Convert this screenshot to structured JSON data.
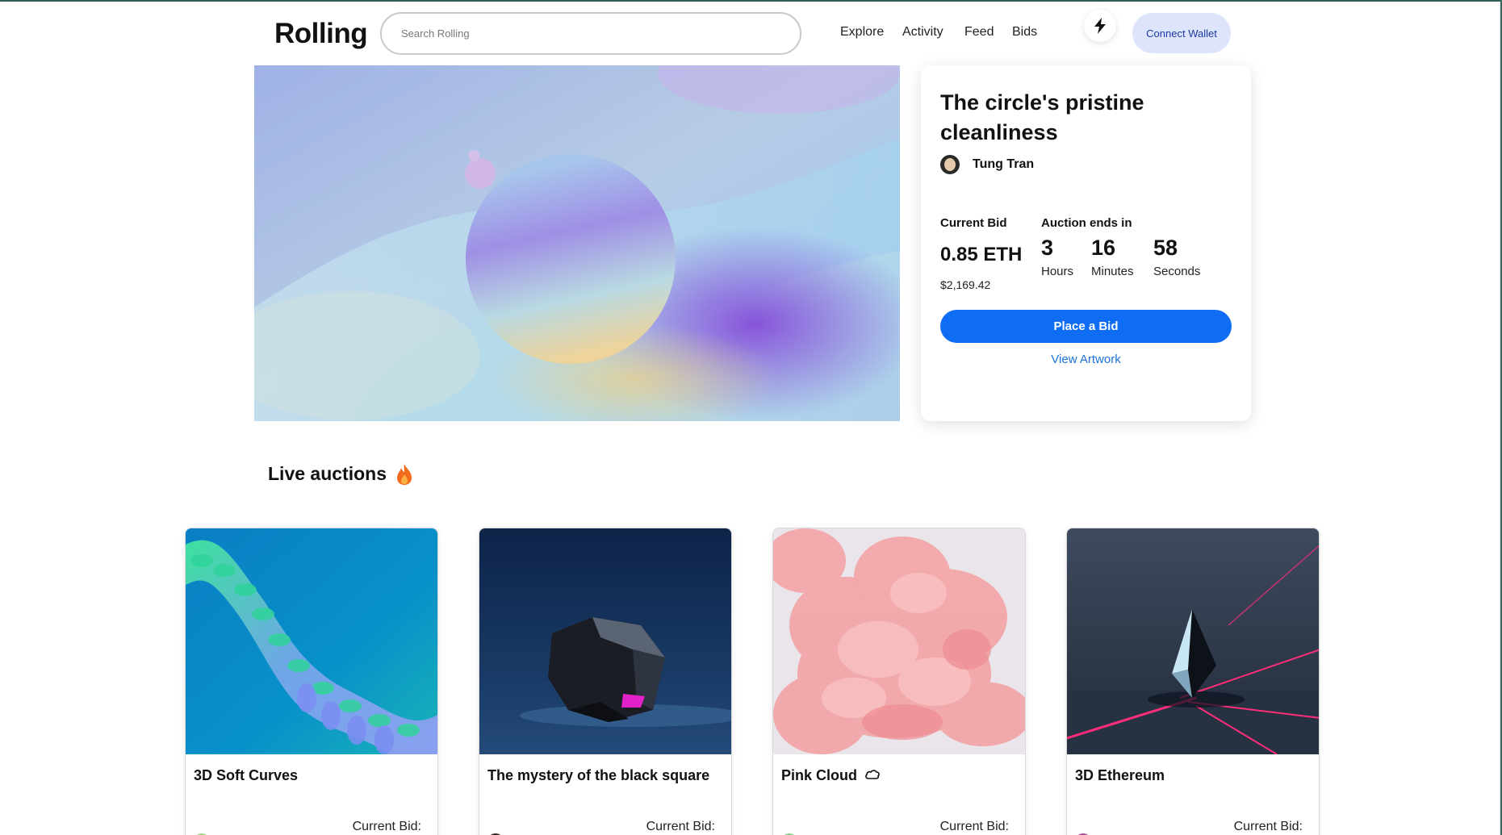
{
  "header": {
    "logo": "Rolling",
    "search_placeholder": "Search Rolling",
    "nav": [
      "Explore",
      "Activity",
      "Feed",
      "Bids"
    ],
    "connect_wallet": "Connect Wallet"
  },
  "featured": {
    "title": "The circle's pristine cleanliness",
    "artist": "Tung Tran",
    "current_bid_label": "Current Bid",
    "bid_eth": "0.85 ETH",
    "bid_usd": "$2,169.42",
    "auction_ends_label": "Auction ends in",
    "hours": "3",
    "hours_label": "Hours",
    "minutes": "16",
    "minutes_label": "Minutes",
    "seconds": "58",
    "seconds_label": "Seconds",
    "place_bid": "Place a Bid",
    "view_artwork": "View Artwork"
  },
  "live_auctions": {
    "title": "Live auctions",
    "cards": [
      {
        "title": "3D Soft Curves",
        "bid_label": "Current Bid:"
      },
      {
        "title": "The mystery of the black square",
        "bid_label": "Current Bid:"
      },
      {
        "title": "Pink Cloud",
        "bid_label": "Current Bid:"
      },
      {
        "title": "3D Ethereum",
        "bid_label": "Current Bid:"
      }
    ]
  },
  "colors": {
    "primary": "#0f6df5",
    "wallet_bg": "#dde4fb",
    "wallet_text": "#1d3a9e",
    "link": "#1b72d8"
  },
  "icons": [
    "search-icon",
    "lightning-bolt-icon",
    "fire-icon",
    "cloud-icon",
    "artist-avatar"
  ]
}
